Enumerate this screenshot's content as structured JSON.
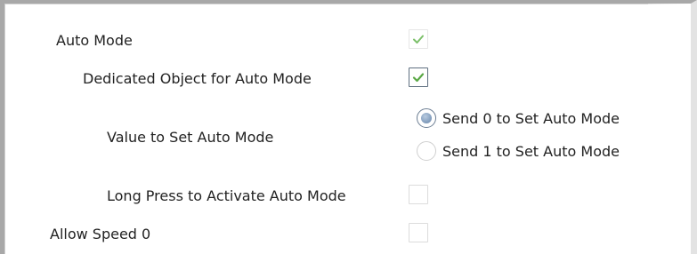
{
  "panel": {
    "colors": {
      "check_green": "#5aa845",
      "radio_selected": "#8aa4c2"
    }
  },
  "settings": {
    "auto_mode": {
      "label": "Auto Mode",
      "checked": true,
      "enabled": false
    },
    "dedicated_object": {
      "label": "Dedicated Object for Auto Mode",
      "checked": true,
      "enabled": true
    },
    "value_to_set": {
      "label": "Value to Set Auto Mode",
      "options": [
        {
          "label": "Send 0 to Set Auto Mode",
          "selected": true
        },
        {
          "label": "Send 1 to Set Auto Mode",
          "selected": false
        }
      ]
    },
    "long_press": {
      "label": "Long Press to Activate Auto Mode",
      "checked": false
    },
    "allow_speed_0": {
      "label": "Allow Speed 0",
      "checked": false
    }
  }
}
